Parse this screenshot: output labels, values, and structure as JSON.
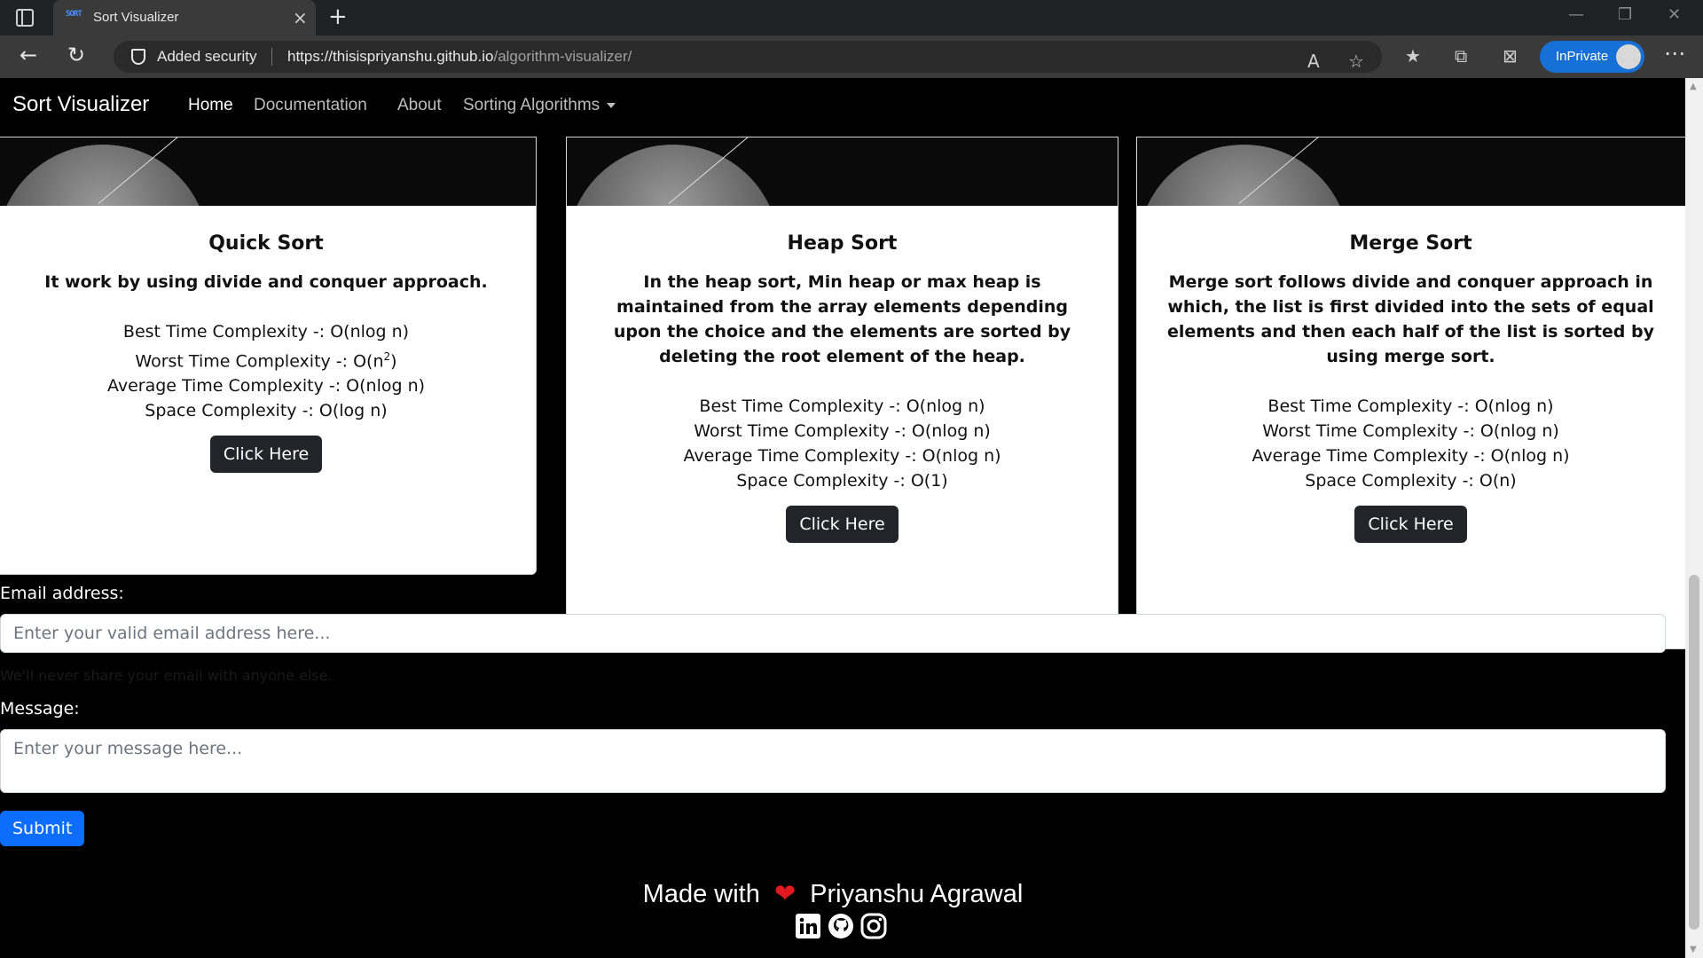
{
  "browser": {
    "tab_title": "Sort Visualizer",
    "favicon_text": "SORT",
    "security_label": "Added security",
    "url_host": "https://thisispriyanshu.github.io",
    "url_path": "/algorithm-visualizer/",
    "inprivate_label": "InPrivate"
  },
  "navbar": {
    "brand": "Sort Visualizer",
    "links": [
      "Home",
      "Documentation",
      "About",
      "Sorting Algorithms"
    ]
  },
  "cards": [
    {
      "title": "Quick Sort",
      "description": "It work by using divide and conquer approach.",
      "best": "Best Time Complexity -: O(nlog n)",
      "worst_prefix": "Worst Time Complexity -: O(n",
      "worst_sup": "2",
      "worst_suffix": ")",
      "average": "Average Time Complexity -: O(nlog n)",
      "space": "Space Complexity -: O(log n)",
      "button": "Click Here"
    },
    {
      "title": "Heap Sort",
      "description": "In the heap sort, Min heap or max heap is maintained from the array elements depending upon the choice and the elements are sorted by deleting the root element of the heap.",
      "best": "Best Time Complexity -: O(nlog n)",
      "worst": "Worst Time Complexity -: O(nlog n)",
      "average": "Average Time Complexity -: O(nlog n)",
      "space": "Space Complexity -: O(1)",
      "button": "Click Here"
    },
    {
      "title": "Merge Sort",
      "description": "Merge sort follows divide and conquer approach in which, the list is first divided into the sets of equal elements and then each half of the list is sorted by using merge sort.",
      "best": "Best Time Complexity -: O(nlog n)",
      "worst": "Worst Time Complexity -: O(nlog n)",
      "average": "Average Time Complexity -: O(nlog n)",
      "space": "Space Complexity -: O(n)",
      "button": "Click Here"
    }
  ],
  "contact": {
    "email_label": "Email address:",
    "email_placeholder": "Enter your valid email address here...",
    "email_hint": "We'll never share your email with anyone else.",
    "message_label": "Message:",
    "message_placeholder": "Enter your message here...",
    "submit": "Submit"
  },
  "footer": {
    "made_with": "Made with",
    "author": "Priyanshu Agrawal",
    "social_icons": [
      "linkedin-icon",
      "github-icon",
      "instagram-icon"
    ]
  }
}
